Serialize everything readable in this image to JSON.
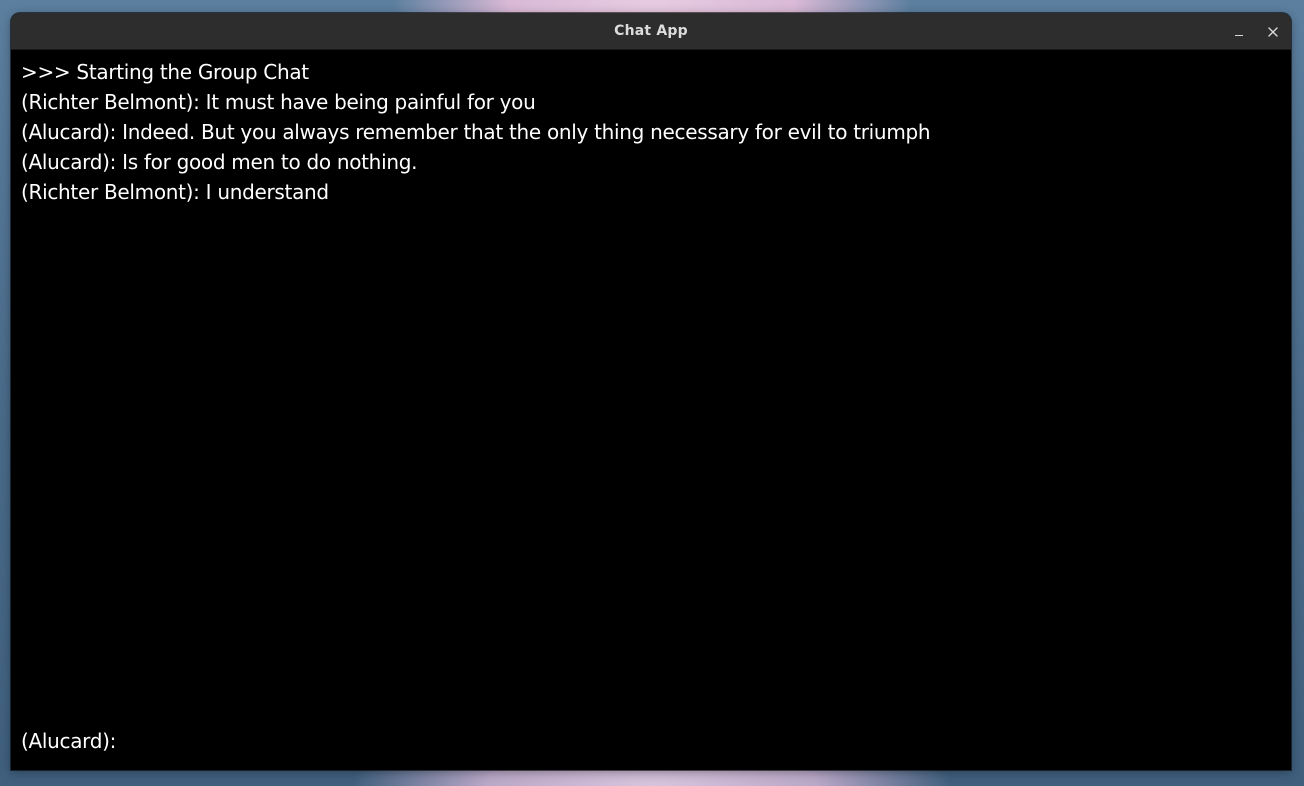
{
  "window": {
    "title": "Chat App",
    "minimize_label": "–",
    "close_icon": "close-icon"
  },
  "chat": {
    "messages": [
      {
        "text": ">>> Starting the Group Chat"
      },
      {
        "text": "(Richter Belmont): It must have being painful for you"
      },
      {
        "text": "(Alucard): Indeed. But you always remember that the only thing necessary for evil to triumph"
      },
      {
        "text": "(Alucard): Is for good men to do nothing."
      },
      {
        "text": "(Richter Belmont): I understand"
      }
    ]
  },
  "input": {
    "prompt": "(Alucard):",
    "value": "",
    "placeholder": ""
  },
  "colors": {
    "background": "#000000",
    "text": "#ffffff",
    "titlebar": "#2d2d2d",
    "title_text": "#dcdcdc"
  }
}
